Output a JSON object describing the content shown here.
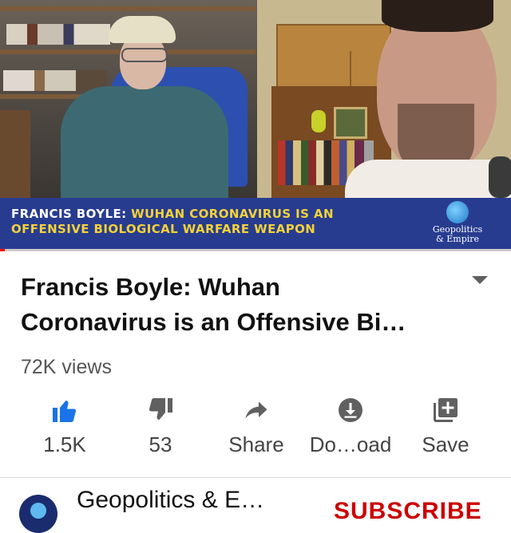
{
  "video": {
    "banner_name": "FRANCIS BOYLE:",
    "banner_line1_highlight": "WUHAN CORONAVIRUS IS AN",
    "banner_line2": "OFFENSIVE BIOLOGICAL WARFARE WEAPON",
    "logo_line1": "Geopolitics",
    "logo_line2": "& Empire",
    "progress_fraction": 0.01
  },
  "details": {
    "title_line1": "Francis Boyle: Wuhan",
    "title_line2": "Coronavirus is an Offensive Bi…",
    "views": "72K views"
  },
  "actions": [
    {
      "icon": "thumbs-up-icon",
      "label": "1.5K",
      "color": "#1a73e8"
    },
    {
      "icon": "thumbs-down-icon",
      "label": "53",
      "color": "#606060"
    },
    {
      "icon": "share-icon",
      "label": "Share",
      "color": "#606060"
    },
    {
      "icon": "download-icon",
      "label": "Do…oad",
      "color": "#606060"
    },
    {
      "icon": "save-icon",
      "label": "Save",
      "color": "#606060"
    }
  ],
  "channel": {
    "name": "Geopolitics & E…",
    "subscribe_label": "SUBSCRIBE"
  },
  "colors": {
    "banner_bg": "#283c8f",
    "banner_highlight": "#f4d23a",
    "subscribe": "#cc0000",
    "progress": "#ff0000"
  }
}
